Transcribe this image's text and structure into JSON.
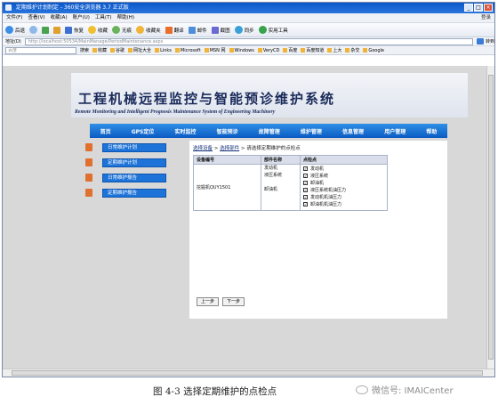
{
  "window": {
    "title": "定期维护计划制定 - 360安全浏览器 3.7 正式版",
    "controls": [
      "_",
      "□",
      "×"
    ]
  },
  "menu": {
    "items": [
      "文件(F)",
      "查看(V)",
      "收藏(A)",
      "账户(U)",
      "工具(T)",
      "帮助(H)"
    ],
    "right": "登录"
  },
  "toolbar": {
    "items": [
      "后退",
      "前进",
      "刷新",
      "主页",
      "恢复",
      "收藏",
      "无痕",
      "收藏夹",
      "翻译",
      "邮件",
      "截图",
      "翻译",
      "同步",
      "实用工具"
    ]
  },
  "address": {
    "label": "地址(D)",
    "url": "http://localhost:50534/MainManage/PeriodMaintenance.aspx",
    "go": "转到"
  },
  "favorites": {
    "search_placeholder": "百度",
    "search_btn": "搜索",
    "items": [
      "收藏",
      "谷歌",
      "网址大全",
      "Links",
      "Microsoft",
      "MSN 网",
      "Windows",
      "VeryCD",
      "百度",
      "百度知道",
      "上大",
      "杂交",
      "Google"
    ]
  },
  "app": {
    "title_cn": "工程机械远程监控与智能预诊维护系统",
    "title_en": "Remote Monitoring and Intelligent Prognosis Maintenance System of Engineering Machinery",
    "nav": [
      "首页",
      "GPS定位",
      "实时监控",
      "智能预诊",
      "故障管理",
      "维护管理",
      "信息管理",
      "用户管理",
      "帮助"
    ],
    "sidebar": [
      "日常维护计划",
      "定期维护计划",
      "日常维护报告",
      "定期维护报告"
    ],
    "breadcrumb": {
      "step1": "选择设备",
      "sep1": " > ",
      "step2": "选择部件",
      "sep2": " > ",
      "step3": "请选择定期维护的点检点"
    },
    "table": {
      "headers": [
        "设备编号",
        "部件名称",
        "点检点"
      ],
      "device": "挖掘机QUY1501",
      "parts": [
        "发动机",
        "液压系统",
        "卸油机"
      ],
      "checkpoints": [
        "发动机",
        "液压系统",
        "卸油机",
        "液压系统机油压力",
        "发动机机油压力",
        "卸油机机油压力"
      ]
    },
    "buttons": {
      "prev": "上一步",
      "next": "下一步"
    }
  },
  "caption": "图 4-3  选择定期维护的点检点",
  "watermark": "微信号: IMAICenter"
}
